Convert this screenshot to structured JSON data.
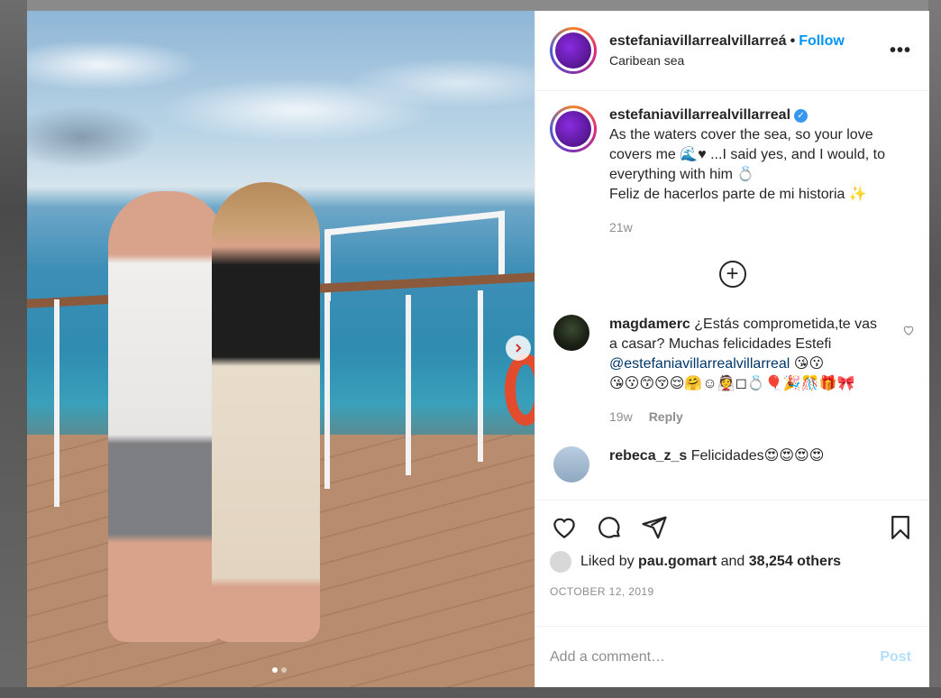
{
  "post": {
    "username": "estefaniavillarrealvillarreal",
    "username_truncated": "estefaniavillarrealvillarreá",
    "separator": "•",
    "follow_label": "Follow",
    "location": "Caribean sea",
    "more_label": "•••",
    "verified_badge": "✓"
  },
  "caption": {
    "username": "estefaniavillarrealvillarreal",
    "text": "As the waters cover the sea, so your love covers me 🌊♥ ...I said yes, and I would, to everything with him 💍",
    "text2": "Feliz de hacerlos parte de mi historia ✨",
    "time": "21w"
  },
  "load_more_label": "+",
  "comments": [
    {
      "username": "magdamerc",
      "text": "¿Estás comprometida,te vas a casar? Muchas felicidades Estefi",
      "mention": "@estefaniavillarrealvillarreal",
      "emoji_line": "😘😗😙😚😌🤗☺👰◻💍🎈🎉🎊🎁🎀",
      "emoji_tail": "😘😗",
      "time": "19w",
      "reply_label": "Reply"
    },
    {
      "username": "rebeca_z_s",
      "text": "Felicidades😍😍😍😍"
    }
  ],
  "actions": {
    "like_icon": "heart-icon",
    "comment_icon": "comment-icon",
    "share_icon": "share-icon",
    "save_icon": "bookmark-icon"
  },
  "likes": {
    "prefix": "Liked by",
    "user": "pau.gomart",
    "middle": "and",
    "count": "38,254 others"
  },
  "date": "OCTOBER 12, 2019",
  "comment_box": {
    "placeholder": "Add a comment…",
    "post_label": "Post"
  },
  "carousel": {
    "total": 2,
    "active": 1
  },
  "colors": {
    "accent": "#0095f6",
    "mention": "#00376b",
    "muted": "#8e8e8e",
    "post_disabled": "#b2dffc",
    "verified": "#3897f0"
  }
}
